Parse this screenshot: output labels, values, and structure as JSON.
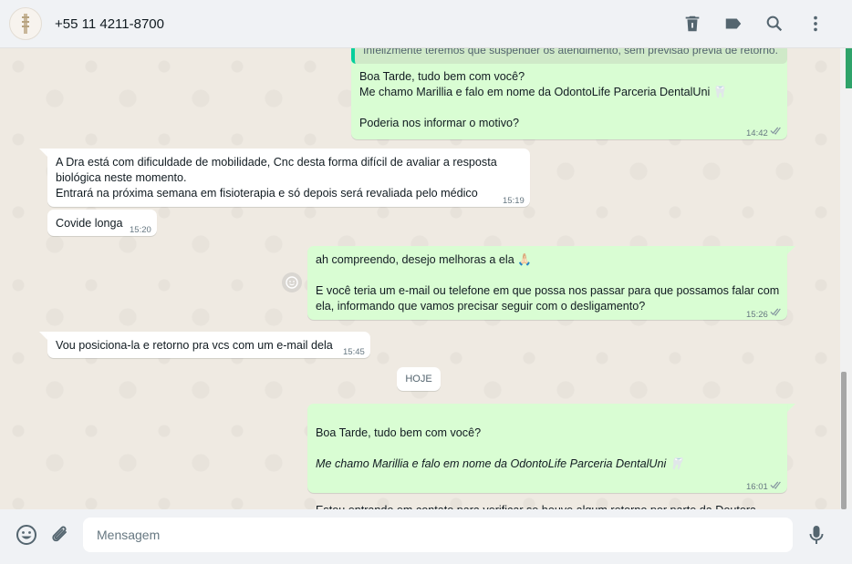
{
  "header": {
    "contact": "+55 11 4211-8700",
    "icons": [
      "delete-icon",
      "label-icon",
      "search-icon",
      "menu-icon"
    ]
  },
  "quoted_text": "Infelizmente teremos  que suspender os atendimento, sem previsão  prévia de retorno.",
  "messages": [
    {
      "dir": "out",
      "text": "Boa Tarde, tudo bem com você?\nMe chamo Marillia e falo em nome da OdontoLife Parceria DentalUni 🦷\n\nPoderia nos informar o motivo?",
      "time": "14:42"
    },
    {
      "dir": "in",
      "text": "A Dra está com dificuldade de mobilidade, Cnc desta forma difícil de avaliar  a   resposta\nbiológica  neste momento.\nEntrará  na próxima semana em fisioterapia  e só depois será  revaliada pelo médico",
      "time": "15:19"
    },
    {
      "dir": "in",
      "text": "Covide longa",
      "time": "15:20"
    },
    {
      "dir": "out",
      "text": "ah compreendo, desejo melhoras a ela 🙏🏻\n\nE você teria um e-mail ou telefone em que possa nos passar para que possamos falar com\nela, informando que vamos precisar seguir com o desligamento?",
      "time": "15:26"
    },
    {
      "dir": "in",
      "text": "Vou posiciona-la e retorno pra vcs com um e-mail dela",
      "time": "15:45"
    },
    {
      "dir": "out",
      "line1": "Boa Tarde, tudo bem com você?",
      "line2_italic": "Me chamo Marillia e falo em nome da OdontoLife Parceria DentalUni 🦷",
      "line3": "Estou entrando em contato para verificar se houve algum retorno por parte da Doutora\npara que possamos dar continuidade no processo de desligamento?",
      "time": "16:01"
    }
  ],
  "date_chip": "HOJE",
  "composer": {
    "placeholder": "Mensagem",
    "icons": [
      "emoji-icon",
      "attach-icon",
      "mic-icon"
    ]
  },
  "colors": {
    "outgoing": "#d9fdd3",
    "incoming": "#ffffff",
    "read_ticks": "#8696a0"
  }
}
